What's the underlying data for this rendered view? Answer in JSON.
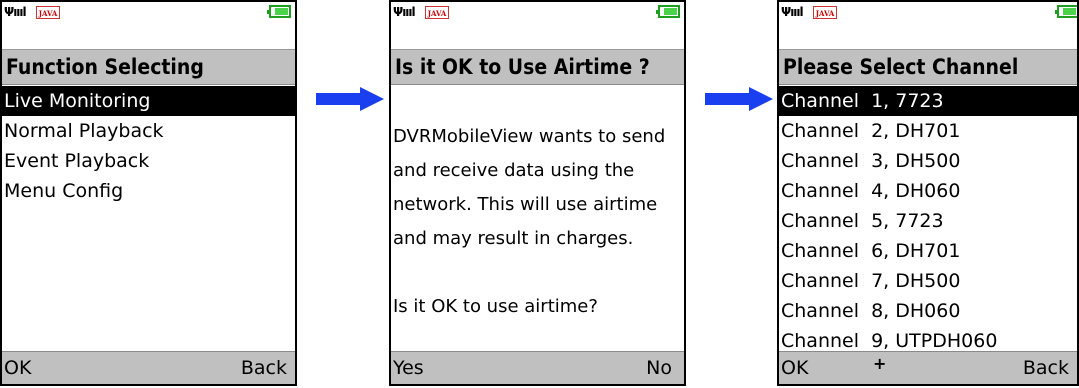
{
  "screens": {
    "function": {
      "status": {
        "java_label": "JAVA"
      },
      "title": "Function Selecting",
      "items": [
        "Live Monitoring",
        "Normal Playback",
        "Event Playback",
        "Menu Config"
      ],
      "selected_index": 0,
      "soft_left": "OK",
      "soft_right": "Back"
    },
    "airtime": {
      "status": {
        "java_label": "JAVA"
      },
      "title": "Is it OK to Use Airtime ?",
      "lines": [
        "DVRMobileView wants to send",
        "and receive data using the",
        "network. This will use airtime",
        "and may result in charges.",
        "",
        "Is it OK to use airtime?"
      ],
      "soft_left": "Yes",
      "soft_right": "No"
    },
    "channel": {
      "status": {
        "java_label": "JAVA"
      },
      "title": "Please Select Channel",
      "items": [
        "Channel  1, 7723",
        "Channel  2, DH701",
        "Channel  3, DH500",
        "Channel  4, DH060",
        "Channel  5, 7723",
        "Channel  6, DH701",
        "Channel  7, DH500",
        "Channel  8, DH060",
        "Channel  9, UTPDH060"
      ],
      "selected_index": 0,
      "soft_left": "OK",
      "soft_right": "Back"
    }
  },
  "icons": {
    "signal": "signal-bars-icon",
    "battery": "battery-icon",
    "java": "java-logo-icon",
    "arrow": "right-arrow-icon",
    "scroll_indicator": "scroll-down-icon"
  },
  "colors": {
    "arrow": "#1a3ff0",
    "battery": "#4cd34c",
    "title_bar": "#c0c0c0",
    "selection": "#000000"
  }
}
